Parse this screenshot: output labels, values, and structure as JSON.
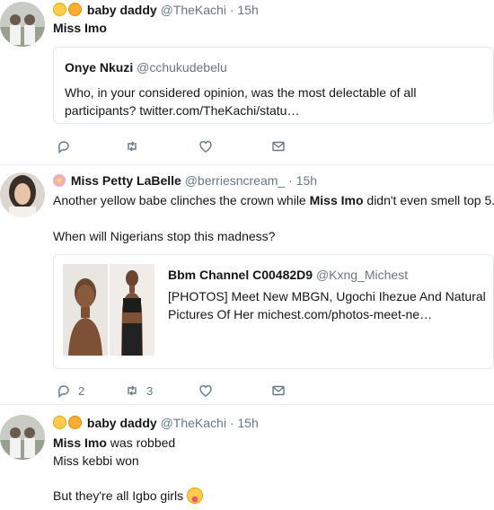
{
  "tweets": [
    {
      "author": {
        "name": "baby daddy",
        "handle": "@TheKachi",
        "time": "15h"
      },
      "text": "Miss Imo",
      "quote": {
        "name": "Onye Nkuzi",
        "handle": "@cchukudebelu",
        "text": "Who, in your considered opinion, was the most delectable of all participants? twitter.com/TheKachi/statu…"
      },
      "actions": {
        "reply": "",
        "retweet": "",
        "like": ""
      }
    },
    {
      "author": {
        "name": "Miss Petty LaBelle",
        "handle": "@berriesncream_",
        "time": "15h"
      },
      "text_before": "Another yellow babe clinches the crown while ",
      "text_bold": "Miss Imo",
      "text_after": " didn't even smell top 5.",
      "text_line2": "When will Nigerians stop this madness?",
      "card": {
        "title_name": "Bbm Channel C00482D9",
        "title_handle": "@Kxng_Michest",
        "description": "[PHOTOS] Meet New MBGN, Ugochi Ihezue And Natural Pictures Of Her michest.com/photos-meet-ne…"
      },
      "actions": {
        "reply": "2",
        "retweet": "3",
        "like": ""
      }
    },
    {
      "author": {
        "name": "baby daddy",
        "handle": "@TheKachi",
        "time": "15h"
      },
      "text_bold": "Miss Imo",
      "text_after": " was robbed",
      "line2": "Miss kebbi won",
      "line3": "But they're all Igbo girls"
    }
  ],
  "separator": " · ",
  "icons": [
    "reply-icon",
    "retweet-icon",
    "like-icon",
    "message-icon"
  ],
  "colors": {
    "text": "#14171a",
    "muted": "#657786",
    "border": "#e1e8ed"
  }
}
